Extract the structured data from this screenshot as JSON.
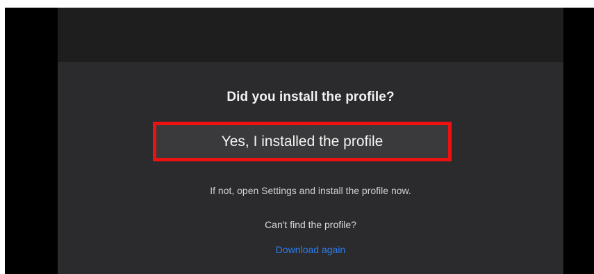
{
  "dialog": {
    "title": "Did you install the profile?",
    "confirm_button": "Yes, I installed the profile",
    "help_text": "If not, open Settings and install the profile now.",
    "cant_find_text": "Can't find the profile?",
    "download_again_link": "Download again"
  },
  "colors": {
    "highlight_border": "#ee1111",
    "link": "#2d7ff0",
    "background": "#2b2b2d",
    "top_bar": "#1e1e1f"
  }
}
